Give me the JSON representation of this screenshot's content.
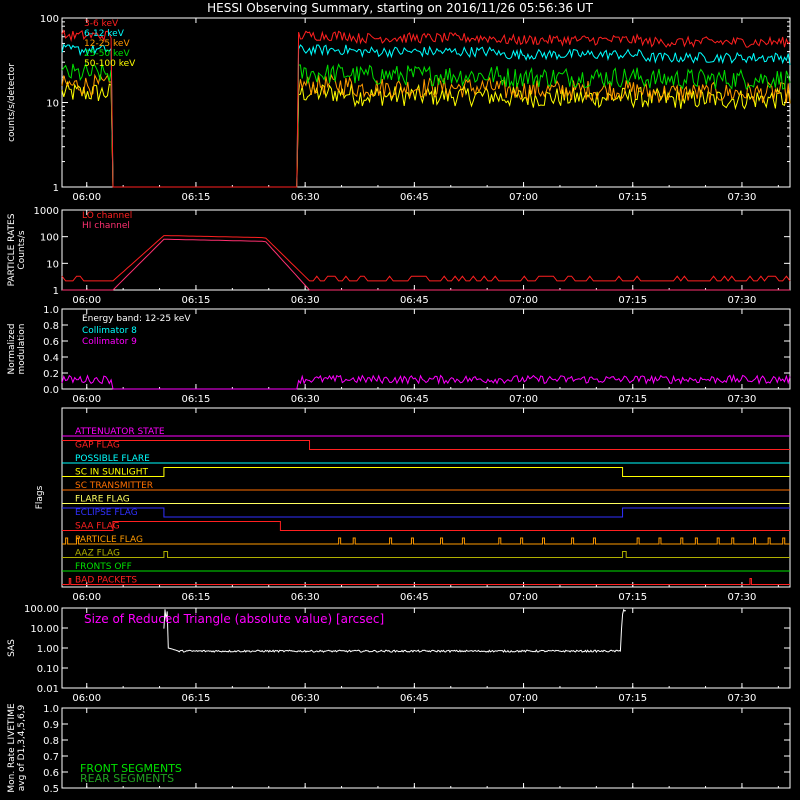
{
  "title": "HESSI Observing Summary, starting on 2016/11/26 05:56:36 UT",
  "colors": {
    "red": "#ff2020",
    "orange": "#ff9a00",
    "yellow": "#ffff00",
    "green": "#00e000",
    "cyan": "#00ffff",
    "magenta": "#ff00ff",
    "blue": "#3030ff",
    "white": "#ffffff",
    "darkred": "#d01010",
    "pink": "#ff3070",
    "olive": "#b0b000",
    "darkgreen": "#20a020"
  },
  "chart_data": [
    {
      "id": "rates",
      "type": "line",
      "ylabel": "counts/s/detector",
      "yscale": "log",
      "ylim": [
        1,
        100
      ],
      "yticks": [
        "1",
        "10",
        "100"
      ],
      "xticks": [
        "06:00",
        "06:15",
        "06:30",
        "06:45",
        "07:00",
        "07:15",
        "07:30"
      ],
      "gap": [
        6.82,
        32.35
      ],
      "series": [
        {
          "name": "3-6 keV",
          "color": "#ff2020",
          "level": [
            62,
            62,
            58,
            55,
            52,
            50
          ]
        },
        {
          "name": "6-12 keV",
          "color": "#00ffff",
          "level": [
            42,
            42,
            40,
            37,
            34,
            32
          ]
        },
        {
          "name": "12-25 keV",
          "color": "#ff9a00",
          "level": [
            16,
            16,
            15,
            14,
            13,
            12
          ]
        },
        {
          "name": "25-50 keV",
          "color": "#00e000",
          "level": [
            22,
            22,
            21,
            20,
            19,
            18
          ]
        },
        {
          "name": "50-100 keV",
          "color": "#ffff00",
          "level": [
            13,
            13,
            12,
            11.5,
            11,
            10.5
          ]
        }
      ]
    },
    {
      "id": "particle",
      "type": "line",
      "ylabel": "PARTICLE RATES Counts/s",
      "yscale": "log",
      "ylim": [
        1,
        1000
      ],
      "yticks": [
        "1",
        "10",
        "100",
        "1000"
      ],
      "series": [
        {
          "name": "LO channel",
          "color": "#ff2020"
        },
        {
          "name": "HI channel",
          "color": "#ff3070"
        }
      ]
    },
    {
      "id": "modulation",
      "type": "line",
      "ylabel": "Normalized modulation",
      "ylim": [
        0,
        1
      ],
      "yticks": [
        "0.0",
        "0.2",
        "0.4",
        "0.6",
        "0.8",
        "1.0"
      ],
      "annotation": "Energy band: 12-25 keV",
      "series": [
        {
          "name": "Collimator 8",
          "color": "#00ffff"
        },
        {
          "name": "Collimator 9",
          "color": "#ff00ff"
        }
      ]
    },
    {
      "id": "flags",
      "type": "line",
      "ylabel": "Flags",
      "rows": [
        {
          "name": "ATTENUATOR STATE",
          "color": "#ff00ff"
        },
        {
          "name": "GAP FLAG",
          "color": "#ff2020"
        },
        {
          "name": "POSSIBLE FLARE",
          "color": "#00ffff"
        },
        {
          "name": "SC IN SUNLIGHT",
          "color": "#ffff00"
        },
        {
          "name": "SC TRANSMITTER",
          "color": "#ff7000"
        },
        {
          "name": "FLARE FLAG",
          "color": "#ffff60"
        },
        {
          "name": "ECLIPSE FLAG",
          "color": "#3030ff"
        },
        {
          "name": "SAA FLAG",
          "color": "#ff2020"
        },
        {
          "name": "PARTICLE FLAG",
          "color": "#ff9a00"
        },
        {
          "name": "AAZ FLAG",
          "color": "#b0b000"
        },
        {
          "name": "FRONTS OFF",
          "color": "#00e000"
        },
        {
          "name": "BAD PACKETS",
          "color": "#ff2020"
        }
      ]
    },
    {
      "id": "sas",
      "type": "line",
      "ylabel": "SAS",
      "yscale": "log",
      "ylim": [
        0.01,
        100
      ],
      "yticks": [
        "0.01",
        "0.10",
        "1.00",
        "10.00",
        "100.00"
      ],
      "annotation": "Size of Reduced Triangle (absolute value) [arcsec]"
    },
    {
      "id": "livetime",
      "type": "line",
      "ylabel": "Mon. Rate LIVETIME avg of D1,3,4,5,6,9",
      "ylim": [
        0.5,
        1.0
      ],
      "yticks": [
        "0.5",
        "0.6",
        "0.7",
        "0.8",
        "0.9",
        "1.0"
      ],
      "series": [
        {
          "name": "FRONT SEGMENTS",
          "color": "#00e000"
        },
        {
          "name": "REAR SEGMENTS",
          "color": "#20a020"
        }
      ]
    }
  ]
}
